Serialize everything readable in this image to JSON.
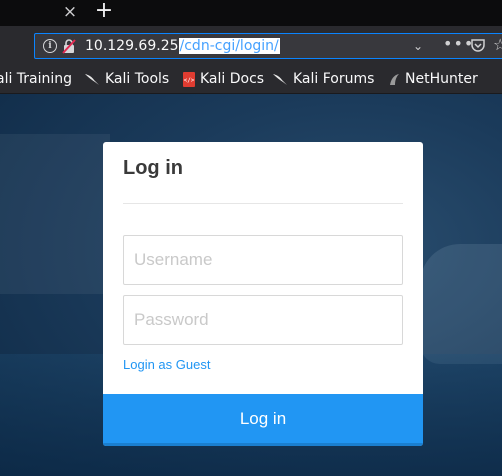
{
  "browser": {
    "tab_close_glyph": "×",
    "new_tab_glyph": "+",
    "url": {
      "host": "10.129.69.25",
      "path": "/cdn-cgi/login/"
    },
    "toolbar_icons": [
      "info-icon",
      "insecure-lock-icon",
      "chevron-down-icon",
      "more-dots-icon",
      "pocket-icon",
      "star-icon"
    ]
  },
  "bookmarks": [
    {
      "label": "ali Training",
      "icon": "kali-dragon-icon"
    },
    {
      "label": "Kali Tools",
      "icon": "kali-dragon-icon"
    },
    {
      "label": "Kali Docs",
      "icon": "kali-docs-icon"
    },
    {
      "label": "Kali Forums",
      "icon": "kali-dragon-icon"
    },
    {
      "label": "NetHunter",
      "icon": "nethunter-icon"
    }
  ],
  "login": {
    "title": "Log in",
    "username_placeholder": "Username",
    "password_placeholder": "Password",
    "guest_link": "Login as Guest",
    "submit_label": "Log in"
  },
  "colors": {
    "accent": "#2196f3",
    "url_highlight": "#45a1ff",
    "chrome_bg": "#2a2a2e"
  }
}
